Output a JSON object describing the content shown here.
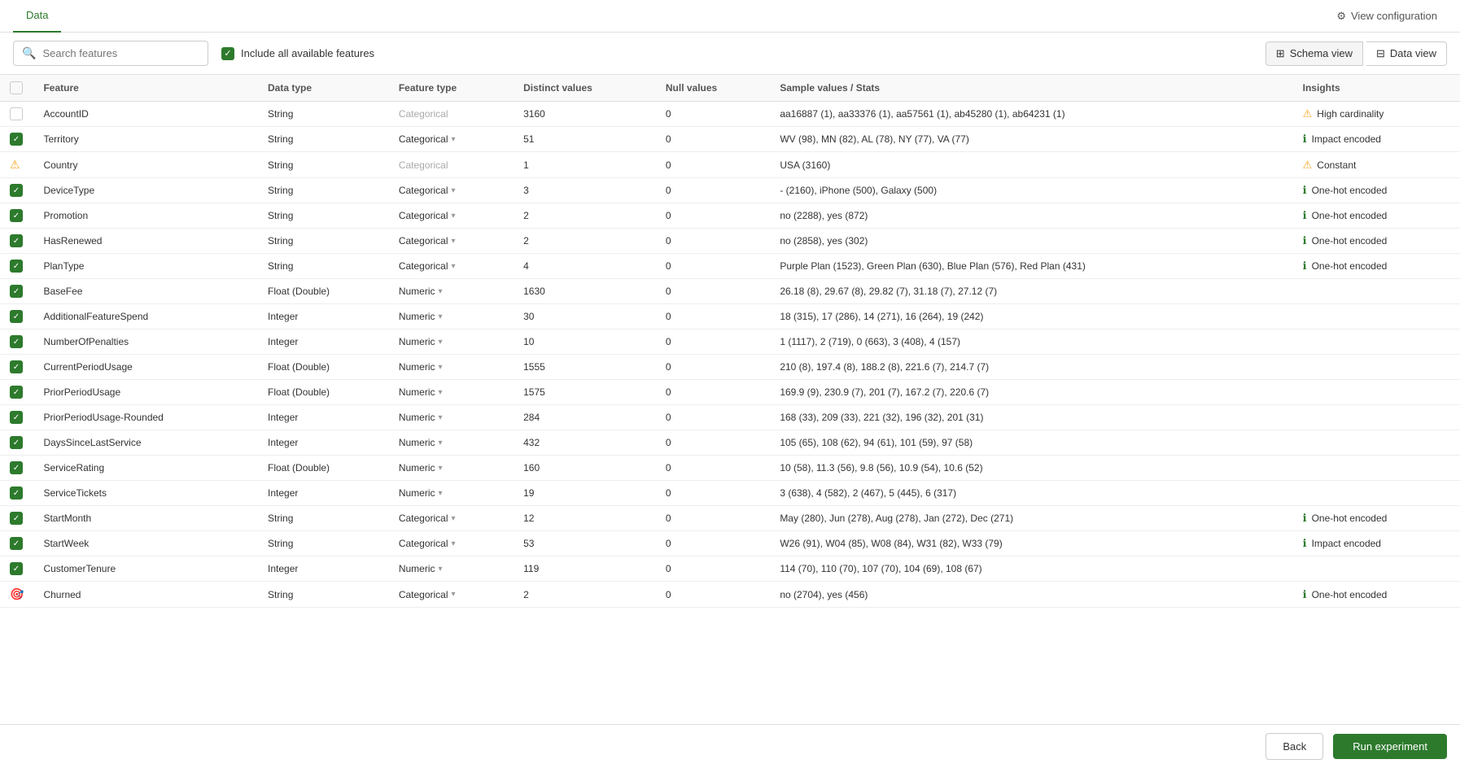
{
  "topTabs": [
    {
      "id": "data",
      "label": "Data",
      "active": true
    }
  ],
  "viewConfig": {
    "label": "View configuration"
  },
  "toolbar": {
    "searchPlaceholder": "Search features",
    "includeAllLabel": "Include all available features",
    "schemaViewLabel": "Schema view",
    "dataViewLabel": "Data view"
  },
  "tableHeaders": [
    {
      "id": "checkbox",
      "label": ""
    },
    {
      "id": "feature",
      "label": "Feature"
    },
    {
      "id": "dataType",
      "label": "Data type"
    },
    {
      "id": "featureType",
      "label": "Feature type"
    },
    {
      "id": "distinctValues",
      "label": "Distinct values"
    },
    {
      "id": "nullValues",
      "label": "Null values"
    },
    {
      "id": "sampleValues",
      "label": "Sample values / Stats"
    },
    {
      "id": "insights",
      "label": "Insights"
    }
  ],
  "rows": [
    {
      "checkState": "unchecked",
      "iconType": "none",
      "feature": "AccountID",
      "dataType": "String",
      "featureType": "Categorical",
      "featureTypeActive": false,
      "hasDropdown": false,
      "distinctValues": "3160",
      "nullValues": "0",
      "sampleValues": "aa16887 (1), aa33376 (1), aa57561 (1), ab45280 (1), ab64231 (1)",
      "insightIcon": "warn",
      "insightText": "High cardinality"
    },
    {
      "checkState": "checked",
      "iconType": "none",
      "feature": "Territory",
      "dataType": "String",
      "featureType": "Categorical",
      "featureTypeActive": true,
      "hasDropdown": true,
      "distinctValues": "51",
      "nullValues": "0",
      "sampleValues": "WV (98), MN (82), AL (78), NY (77), VA (77)",
      "insightIcon": "info",
      "insightText": "Impact encoded"
    },
    {
      "checkState": "warn",
      "iconType": "warn",
      "feature": "Country",
      "dataType": "String",
      "featureType": "Categorical",
      "featureTypeActive": false,
      "hasDropdown": false,
      "distinctValues": "1",
      "nullValues": "0",
      "sampleValues": "USA (3160)",
      "insightIcon": "warn",
      "insightText": "Constant"
    },
    {
      "checkState": "checked",
      "iconType": "none",
      "feature": "DeviceType",
      "dataType": "String",
      "featureType": "Categorical",
      "featureTypeActive": true,
      "hasDropdown": true,
      "distinctValues": "3",
      "nullValues": "0",
      "sampleValues": "- (2160), iPhone (500), Galaxy (500)",
      "insightIcon": "info",
      "insightText": "One-hot encoded"
    },
    {
      "checkState": "checked",
      "iconType": "none",
      "feature": "Promotion",
      "dataType": "String",
      "featureType": "Categorical",
      "featureTypeActive": true,
      "hasDropdown": true,
      "distinctValues": "2",
      "nullValues": "0",
      "sampleValues": "no (2288), yes (872)",
      "insightIcon": "info",
      "insightText": "One-hot encoded"
    },
    {
      "checkState": "checked",
      "iconType": "none",
      "feature": "HasRenewed",
      "dataType": "String",
      "featureType": "Categorical",
      "featureTypeActive": true,
      "hasDropdown": true,
      "distinctValues": "2",
      "nullValues": "0",
      "sampleValues": "no (2858), yes (302)",
      "insightIcon": "info",
      "insightText": "One-hot encoded"
    },
    {
      "checkState": "checked",
      "iconType": "none",
      "feature": "PlanType",
      "dataType": "String",
      "featureType": "Categorical",
      "featureTypeActive": true,
      "hasDropdown": true,
      "distinctValues": "4",
      "nullValues": "0",
      "sampleValues": "Purple Plan (1523), Green Plan (630), Blue Plan (576), Red Plan (431)",
      "insightIcon": "info",
      "insightText": "One-hot encoded"
    },
    {
      "checkState": "checked",
      "iconType": "none",
      "feature": "BaseFee",
      "dataType": "Float (Double)",
      "featureType": "Numeric",
      "featureTypeActive": true,
      "hasDropdown": true,
      "distinctValues": "1630",
      "nullValues": "0",
      "sampleValues": "26.18 (8), 29.67 (8), 29.82 (7), 31.18 (7), 27.12 (7)",
      "insightIcon": "none",
      "insightText": ""
    },
    {
      "checkState": "checked",
      "iconType": "none",
      "feature": "AdditionalFeatureSpend",
      "dataType": "Integer",
      "featureType": "Numeric",
      "featureTypeActive": true,
      "hasDropdown": true,
      "distinctValues": "30",
      "nullValues": "0",
      "sampleValues": "18 (315), 17 (286), 14 (271), 16 (264), 19 (242)",
      "insightIcon": "none",
      "insightText": ""
    },
    {
      "checkState": "checked",
      "iconType": "none",
      "feature": "NumberOfPenalties",
      "dataType": "Integer",
      "featureType": "Numeric",
      "featureTypeActive": true,
      "hasDropdown": true,
      "distinctValues": "10",
      "nullValues": "0",
      "sampleValues": "1 (1117), 2 (719), 0 (663), 3 (408), 4 (157)",
      "insightIcon": "none",
      "insightText": ""
    },
    {
      "checkState": "checked",
      "iconType": "none",
      "feature": "CurrentPeriodUsage",
      "dataType": "Float (Double)",
      "featureType": "Numeric",
      "featureTypeActive": true,
      "hasDropdown": true,
      "distinctValues": "1555",
      "nullValues": "0",
      "sampleValues": "210 (8), 197.4 (8), 188.2 (8), 221.6 (7), 214.7 (7)",
      "insightIcon": "none",
      "insightText": ""
    },
    {
      "checkState": "checked",
      "iconType": "none",
      "feature": "PriorPeriodUsage",
      "dataType": "Float (Double)",
      "featureType": "Numeric",
      "featureTypeActive": true,
      "hasDropdown": true,
      "distinctValues": "1575",
      "nullValues": "0",
      "sampleValues": "169.9 (9), 230.9 (7), 201 (7), 167.2 (7), 220.6 (7)",
      "insightIcon": "none",
      "insightText": ""
    },
    {
      "checkState": "checked",
      "iconType": "none",
      "feature": "PriorPeriodUsage-Rounded",
      "dataType": "Integer",
      "featureType": "Numeric",
      "featureTypeActive": true,
      "hasDropdown": true,
      "distinctValues": "284",
      "nullValues": "0",
      "sampleValues": "168 (33), 209 (33), 221 (32), 196 (32), 201 (31)",
      "insightIcon": "none",
      "insightText": ""
    },
    {
      "checkState": "checked",
      "iconType": "none",
      "feature": "DaysSinceLastService",
      "dataType": "Integer",
      "featureType": "Numeric",
      "featureTypeActive": true,
      "hasDropdown": true,
      "distinctValues": "432",
      "nullValues": "0",
      "sampleValues": "105 (65), 108 (62), 94 (61), 101 (59), 97 (58)",
      "insightIcon": "none",
      "insightText": ""
    },
    {
      "checkState": "checked",
      "iconType": "none",
      "feature": "ServiceRating",
      "dataType": "Float (Double)",
      "featureType": "Numeric",
      "featureTypeActive": true,
      "hasDropdown": true,
      "distinctValues": "160",
      "nullValues": "0",
      "sampleValues": "10 (58), 11.3 (56), 9.8 (56), 10.9 (54), 10.6 (52)",
      "insightIcon": "none",
      "insightText": ""
    },
    {
      "checkState": "checked",
      "iconType": "none",
      "feature": "ServiceTickets",
      "dataType": "Integer",
      "featureType": "Numeric",
      "featureTypeActive": true,
      "hasDropdown": true,
      "distinctValues": "19",
      "nullValues": "0",
      "sampleValues": "3 (638), 4 (582), 2 (467), 5 (445), 6 (317)",
      "insightIcon": "none",
      "insightText": ""
    },
    {
      "checkState": "checked",
      "iconType": "none",
      "feature": "StartMonth",
      "dataType": "String",
      "featureType": "Categorical",
      "featureTypeActive": true,
      "hasDropdown": true,
      "distinctValues": "12",
      "nullValues": "0",
      "sampleValues": "May (280), Jun (278), Aug (278), Jan (272), Dec (271)",
      "insightIcon": "info",
      "insightText": "One-hot encoded"
    },
    {
      "checkState": "checked",
      "iconType": "none",
      "feature": "StartWeek",
      "dataType": "String",
      "featureType": "Categorical",
      "featureTypeActive": true,
      "hasDropdown": true,
      "distinctValues": "53",
      "nullValues": "0",
      "sampleValues": "W26 (91), W04 (85), W08 (84), W31 (82), W33 (79)",
      "insightIcon": "info",
      "insightText": "Impact encoded"
    },
    {
      "checkState": "checked",
      "iconType": "none",
      "feature": "CustomerTenure",
      "dataType": "Integer",
      "featureType": "Numeric",
      "featureTypeActive": true,
      "hasDropdown": true,
      "distinctValues": "119",
      "nullValues": "0",
      "sampleValues": "114 (70), 110 (70), 107 (70), 104 (69), 108 (67)",
      "insightIcon": "none",
      "insightText": ""
    },
    {
      "checkState": "target",
      "iconType": "target",
      "feature": "Churned",
      "dataType": "String",
      "featureType": "Categorical",
      "featureTypeActive": true,
      "hasDropdown": true,
      "distinctValues": "2",
      "nullValues": "0",
      "sampleValues": "no (2704), yes (456)",
      "insightIcon": "info",
      "insightText": "One-hot encoded"
    }
  ],
  "bottomBar": {
    "backLabel": "Back",
    "runLabel": "Run experiment"
  }
}
